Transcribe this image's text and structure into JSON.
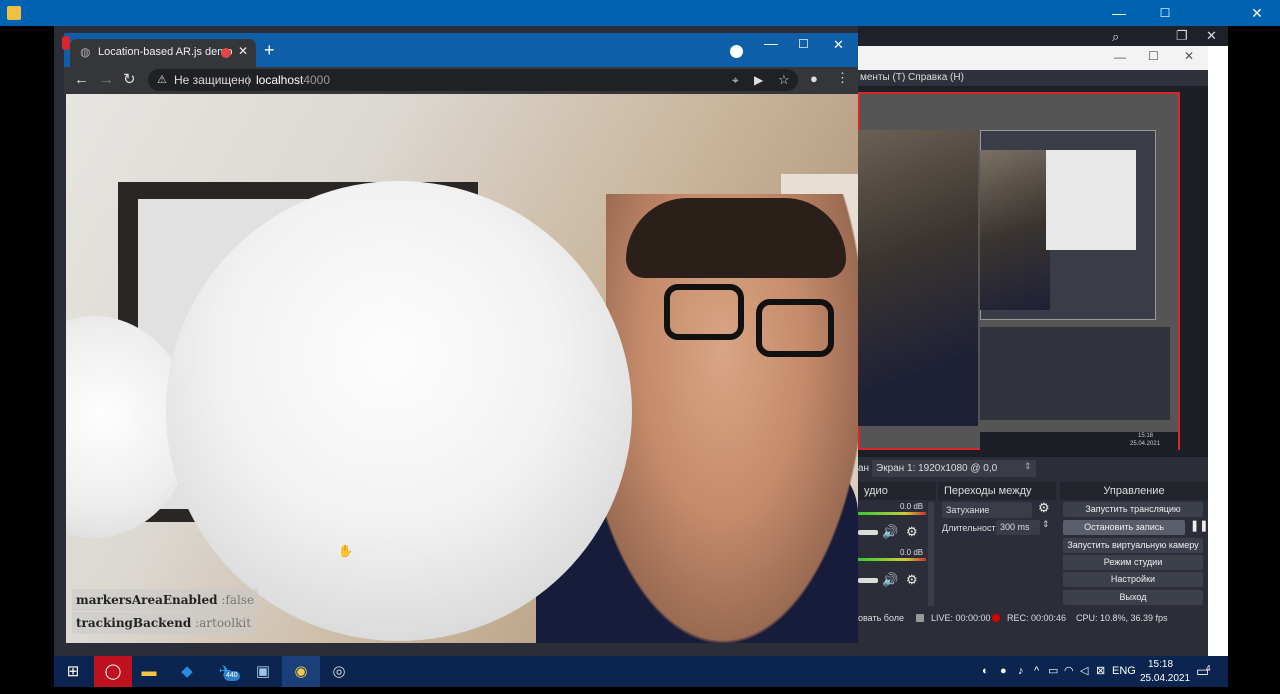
{
  "outer_window": {
    "minimize_icon": "—",
    "maximize_icon": "☐",
    "close_icon": "✕"
  },
  "obs": {
    "menu_text": "менты (T)   Справка (H)",
    "scene_label": "Экран 1: 1920x1080 @ 0,0",
    "scene_prefix": "ан",
    "panels": {
      "audio_title": "удио",
      "transitions_title": "Переходы между сце...",
      "controls_title": "Управление"
    },
    "audio": {
      "db1": "0.0 dB",
      "db2": "0.0 dB"
    },
    "transition": {
      "selected": "Затухание",
      "duration_label": "Длительность",
      "duration_value": "300 ms"
    },
    "controls": {
      "start_stream": "Запустить трансляцию",
      "stop_recording": "Остановить запись",
      "start_virtual_cam": "Запустить виртуальную камеру",
      "studio_mode": "Режим студии",
      "settings": "Настройки",
      "exit": "Выход"
    },
    "status": {
      "left": "овать боле",
      "live": "LIVE: 00:00:00",
      "rec": "REC: 00:00:46",
      "cpu": "CPU: 10.8%, 36.39 fps"
    }
  },
  "chrome": {
    "tab_title": "Location-based AR.js demo",
    "new_tab": "+",
    "security": "Не защищено",
    "url_host": "localhost",
    "url_port": ":4000"
  },
  "ar_overlay": {
    "markers_key": "markersAreaEnabled",
    "markers_value": ":false",
    "tracking_key": "trackingBackend",
    "tracking_value": ":artoolkit"
  },
  "taskbar": {
    "telegram_badge": "440",
    "lang": "ENG",
    "time": "15:18",
    "date": "25.04.2021",
    "notification_count": "4"
  },
  "mini_preview": {
    "time": "15:18",
    "date": "25.04.2021"
  }
}
